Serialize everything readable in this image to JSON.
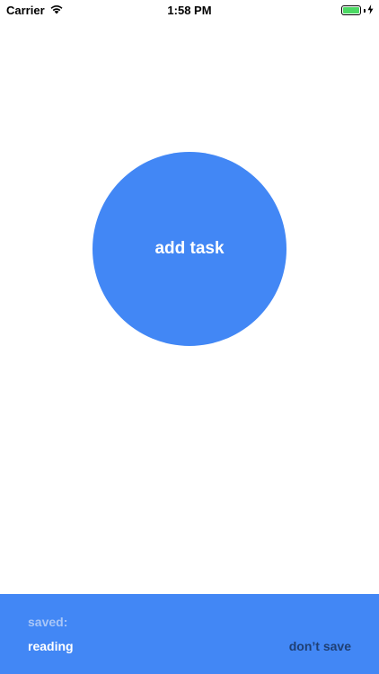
{
  "status_bar": {
    "carrier": "Carrier",
    "time": "1:58 PM",
    "battery_level": 1.0,
    "battery_color": "#4cd964"
  },
  "main": {
    "add_task_label": "add task",
    "button_color": "#4287f5"
  },
  "bottom_panel": {
    "saved_label": "saved:",
    "saved_item": "reading",
    "dont_save_label": "don’t save",
    "panel_color": "#4287f5"
  }
}
